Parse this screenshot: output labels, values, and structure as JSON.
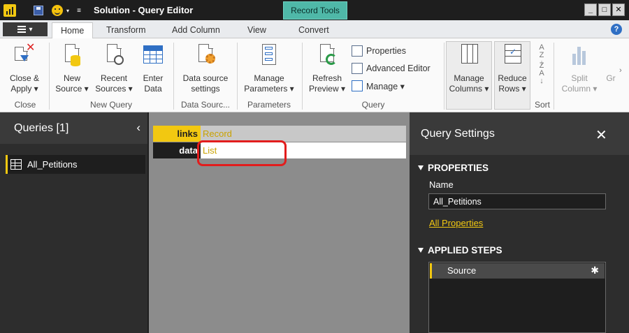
{
  "window": {
    "title": "Solution - Query Editor",
    "context_tab": "Record Tools",
    "controls": {
      "minimize": "_",
      "maximize": "□",
      "close": "✕"
    }
  },
  "ribbon_tabs": [
    "Home",
    "Transform",
    "Add Column",
    "View",
    "Convert"
  ],
  "help_label": "?",
  "ribbon": {
    "close_apply": {
      "line1": "Close &",
      "line2": "Apply ▾"
    },
    "new_source": {
      "line1": "New",
      "line2": "Source ▾"
    },
    "recent_sources": {
      "line1": "Recent",
      "line2": "Sources ▾"
    },
    "enter_data": {
      "line1": "Enter",
      "line2": "Data"
    },
    "data_source_settings": {
      "line1": "Data source",
      "line2": "settings"
    },
    "manage_parameters": {
      "line1": "Manage",
      "line2": "Parameters ▾"
    },
    "refresh_preview": {
      "line1": "Refresh",
      "line2": "Preview ▾"
    },
    "properties": "Properties",
    "advanced_editor": "Advanced Editor",
    "manage": "Manage ▾",
    "manage_columns": {
      "line1": "Manage",
      "line2": "Columns ▾"
    },
    "reduce_rows": {
      "line1": "Reduce",
      "line2": "Rows ▾"
    },
    "split_column": {
      "line1": "Split",
      "line2": "Column ▾"
    },
    "group_by_partial": "Gr",
    "groups": [
      "Close",
      "New Query",
      "Data Sourc...",
      "Parameters",
      "Query",
      "Sort"
    ]
  },
  "queries_panel": {
    "title": "Queries [1]",
    "collapse_glyph": "‹",
    "items": [
      {
        "label": "All_Petitions"
      }
    ]
  },
  "record": {
    "rows": [
      {
        "key": "links",
        "value": "Record"
      },
      {
        "key": "data",
        "value": "List"
      }
    ]
  },
  "query_settings": {
    "title": "Query Settings",
    "close_glyph": "✕",
    "properties_header": "PROPERTIES",
    "name_label": "Name",
    "name_value": "All_Petitions",
    "all_properties_link": "All Properties",
    "applied_steps_header": "APPLIED STEPS",
    "steps": [
      {
        "label": "Source"
      }
    ]
  },
  "colors": {
    "accent": "#f2c811",
    "context_tab": "#4fb8a8",
    "dark_panel": "#2d2d2d",
    "center_bg": "#8c8c8c",
    "highlight_red": "#e21d1d"
  }
}
